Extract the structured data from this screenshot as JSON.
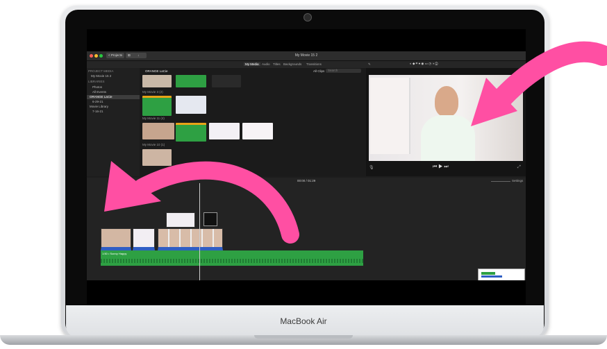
{
  "laptop": {
    "brand": "MacBook Air"
  },
  "app": {
    "title": "My Movie 15 2",
    "back_button": "< Projects",
    "tabs": [
      "My Media",
      "Audio",
      "Titles",
      "Backgrounds",
      "Transitions"
    ],
    "filter": "All Clips",
    "search_placeholder": "Search",
    "browser_title": "ORANGE LaCie",
    "timecode": "00:00 / 01:29",
    "settings": "Settings"
  },
  "sidebar": {
    "section_project": "PROJECT MEDIA",
    "project": "My Movie 15 2",
    "section_libraries": "LIBRARIES",
    "items": [
      "Photos",
      "All Events",
      "ORANGE LaCie",
      "6-29-21",
      "Movie Library",
      "7-16-21"
    ]
  },
  "browser": {
    "groups": [
      "My Movie 3 (2)",
      "My Movie 11 (4)",
      "My Movie 10 (1)"
    ]
  },
  "timeline": {
    "audio_label": "1:50 • Sunny Happy"
  },
  "colors": {
    "accent": "#ff4fa3",
    "green": "#2ea043",
    "blue": "#2f5ec4"
  }
}
